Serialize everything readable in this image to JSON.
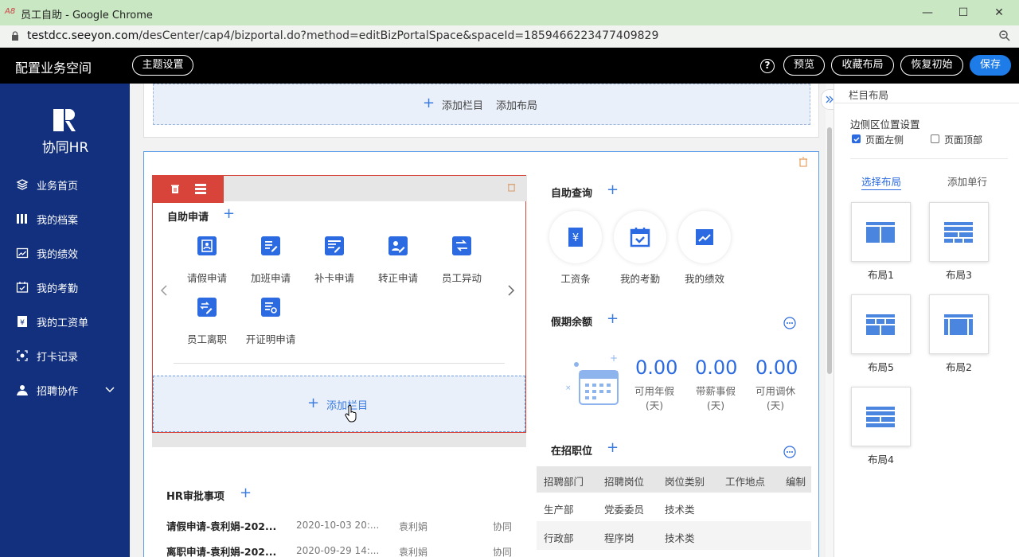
{
  "browser": {
    "window_title": "员工自助 - Google Chrome",
    "url_domain": "testdcc.seeyon.com",
    "url_path": "/desCenter/cap4/bizportal.do?method=editBizPortalSpace&spaceId=1859466223477409829",
    "minimize": "—",
    "maximize": "☐",
    "close": "✕"
  },
  "header": {
    "title": "配置业务空间",
    "theme_button": "主题设置",
    "help": "?",
    "preview": "预览",
    "collect_layout": "收藏布局",
    "restore": "恢复初始",
    "save": "保存"
  },
  "sidebar": {
    "logo_text": "协同HR",
    "items": [
      {
        "label": "业务首页",
        "icon": "layers-icon"
      },
      {
        "label": "我的档案",
        "icon": "books-icon"
      },
      {
        "label": "我的绩效",
        "icon": "chart-icon"
      },
      {
        "label": "我的考勤",
        "icon": "calendar-check-icon"
      },
      {
        "label": "我的工资单",
        "icon": "salary-icon"
      },
      {
        "label": "打卡记录",
        "icon": "clock-in-icon"
      },
      {
        "label": "招聘协作",
        "icon": "people-icon"
      }
    ]
  },
  "main": {
    "top_add": {
      "add_column": "添加栏目",
      "add_layout": "添加布局"
    },
    "self_apply": {
      "title": "自助申请",
      "items": [
        "请假申请",
        "加班申请",
        "补卡申请",
        "转正申请",
        "员工异动",
        "员工离职",
        "开证明申请"
      ]
    },
    "add_column_inner": "添加栏目",
    "self_query": {
      "title": "自助查询",
      "items": [
        "工资条",
        "我的考勤",
        "我的绩效"
      ]
    },
    "leave_balance": {
      "title": "假期余额",
      "stats": [
        {
          "value": "0.00",
          "label1": "可用年假",
          "label2": "(天)"
        },
        {
          "value": "0.00",
          "label1": "带薪事假",
          "label2": "(天)"
        },
        {
          "value": "0.00",
          "label1": "可用调休",
          "label2": "(天)"
        }
      ]
    },
    "recruiting": {
      "title": "在招职位",
      "columns": [
        "招聘部门",
        "招聘岗位",
        "岗位类别",
        "工作地点",
        "编制"
      ],
      "rows": [
        [
          "生产部",
          "党委委员",
          "技术类"
        ],
        [
          "行政部",
          "程序岗",
          "技术类"
        ]
      ]
    },
    "hr_approvals": {
      "title": "HR审批事项",
      "rows": [
        {
          "title": "请假申请-袁利娟-202...",
          "date": "2020-10-03 20:...",
          "person": "袁利娟",
          "type": "协同"
        },
        {
          "title": "离职申请-袁利娟-202...",
          "date": "2020-09-29 14:...",
          "person": "袁利娟",
          "type": "协同"
        }
      ]
    }
  },
  "right_panel": {
    "title": "栏目布局",
    "side_position_label": "边侧区位置设置",
    "option_left": "页面左侧",
    "option_left_checked": true,
    "option_top": "页面顶部",
    "option_top_checked": false,
    "tab_select_layout": "选择布局",
    "tab_add_row": "添加单行",
    "layouts": [
      "布局1",
      "布局3",
      "布局5",
      "布局2",
      "布局4"
    ]
  },
  "colors": {
    "accent": "#2b6ae0",
    "sidebar": "#12307d",
    "header": "#000000",
    "danger": "#d9443a"
  }
}
